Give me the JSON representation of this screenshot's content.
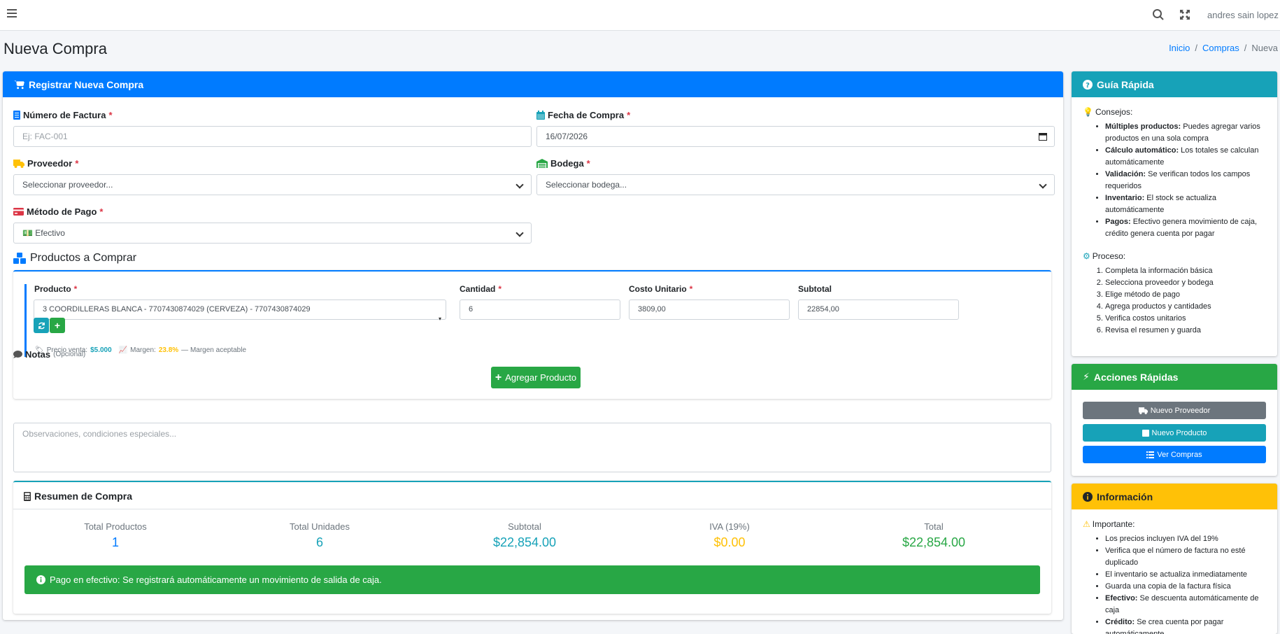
{
  "navbar": {
    "user_name": "andres sain lopez"
  },
  "page": {
    "title": "Nueva Compra",
    "breadcrumb": [
      "Inicio",
      "Compras",
      "Nueva"
    ]
  },
  "form_card": {
    "title": "Registrar Nueva Compra",
    "invoice": {
      "label": "Número de Factura",
      "placeholder": "Ej: FAC-001"
    },
    "date": {
      "label": "Fecha de Compra",
      "value": "16/07/2026"
    },
    "supplier": {
      "label": "Proveedor",
      "value": "Seleccionar proveedor..."
    },
    "warehouse": {
      "label": "Bodega",
      "value": "Seleccionar bodega..."
    },
    "payment": {
      "label": "Método de Pago",
      "icon": "💵",
      "value": "Efectivo"
    },
    "products_section": "Productos a Comprar",
    "product_row": {
      "product_label": "Producto",
      "product_value": "3 COORDILLERAS BLANCA - 7707430874029 (CERVEZA) - 7707430874029",
      "qty_label": "Cantidad",
      "qty_value": "6",
      "cost_label": "Costo Unitario",
      "cost_value": "3809,00",
      "subtotal_label": "Subtotal",
      "subtotal_value": "22854,00",
      "price_label": "Precio venta:",
      "price_value": "$5.000",
      "margin_label": "Margen:",
      "margin_value": "23.8%",
      "margin_note": "— Margen aceptable"
    },
    "add_product": "Agregar Producto",
    "notes": {
      "label": "Notas",
      "optional": "(Opcional)",
      "placeholder": "Observaciones, condiciones especiales..."
    },
    "summary": {
      "title": "Resumen de Compra",
      "stats": [
        {
          "label": "Total Productos",
          "value": "1",
          "color": "#007bff"
        },
        {
          "label": "Total Unidades",
          "value": "6",
          "color": "#17a2b8"
        },
        {
          "label": "Subtotal",
          "value": "$22,854.00",
          "color": "#17a2b8"
        },
        {
          "label": "IVA (19%)",
          "value": "$0.00",
          "color": "#ffc107"
        },
        {
          "label": "Total",
          "value": "$22,854.00",
          "color": "#28a745"
        }
      ],
      "alert": "Pago en efectivo: Se registrará automáticamente un movimiento de salida de caja."
    }
  },
  "guide": {
    "title": "Guía Rápida",
    "tips_title": "Consejos:",
    "tips": [
      {
        "b": "Múltiples productos:",
        "t": " Puedes agregar varios productos en una sola compra"
      },
      {
        "b": "Cálculo automático:",
        "t": " Los totales se calculan automáticamente"
      },
      {
        "b": "Validación:",
        "t": " Se verifican todos los campos requeridos"
      },
      {
        "b": "Inventario:",
        "t": " El stock se actualiza automáticamente"
      },
      {
        "b": "Pagos:",
        "t": " Efectivo genera movimiento de caja, crédito genera cuenta por pagar"
      }
    ],
    "process_title": "Proceso:",
    "process": [
      "Completa la información básica",
      "Selecciona proveedor y bodega",
      "Elige método de pago",
      "Agrega productos y cantidades",
      "Verifica costos unitarios",
      "Revisa el resumen y guarda"
    ]
  },
  "quick_actions": {
    "title": "Acciones Rápidas",
    "new_supplier": "Nuevo Proveedor",
    "new_product": "Nuevo Producto",
    "view_purchases": "Ver Compras"
  },
  "info": {
    "title": "Información",
    "important_title": "Importante:",
    "items": [
      {
        "b": "",
        "t": "Los precios incluyen IVA del 19%"
      },
      {
        "b": "",
        "t": "Verifica que el número de factura no esté duplicado"
      },
      {
        "b": "",
        "t": "El inventario se actualiza inmediatamente"
      },
      {
        "b": "",
        "t": "Guarda una copia de la factura física"
      },
      {
        "b": "Efectivo:",
        "t": " Se descuenta automáticamente de caja"
      },
      {
        "b": "Crédito:",
        "t": " Se crea cuenta por pagar automáticamente"
      }
    ]
  }
}
